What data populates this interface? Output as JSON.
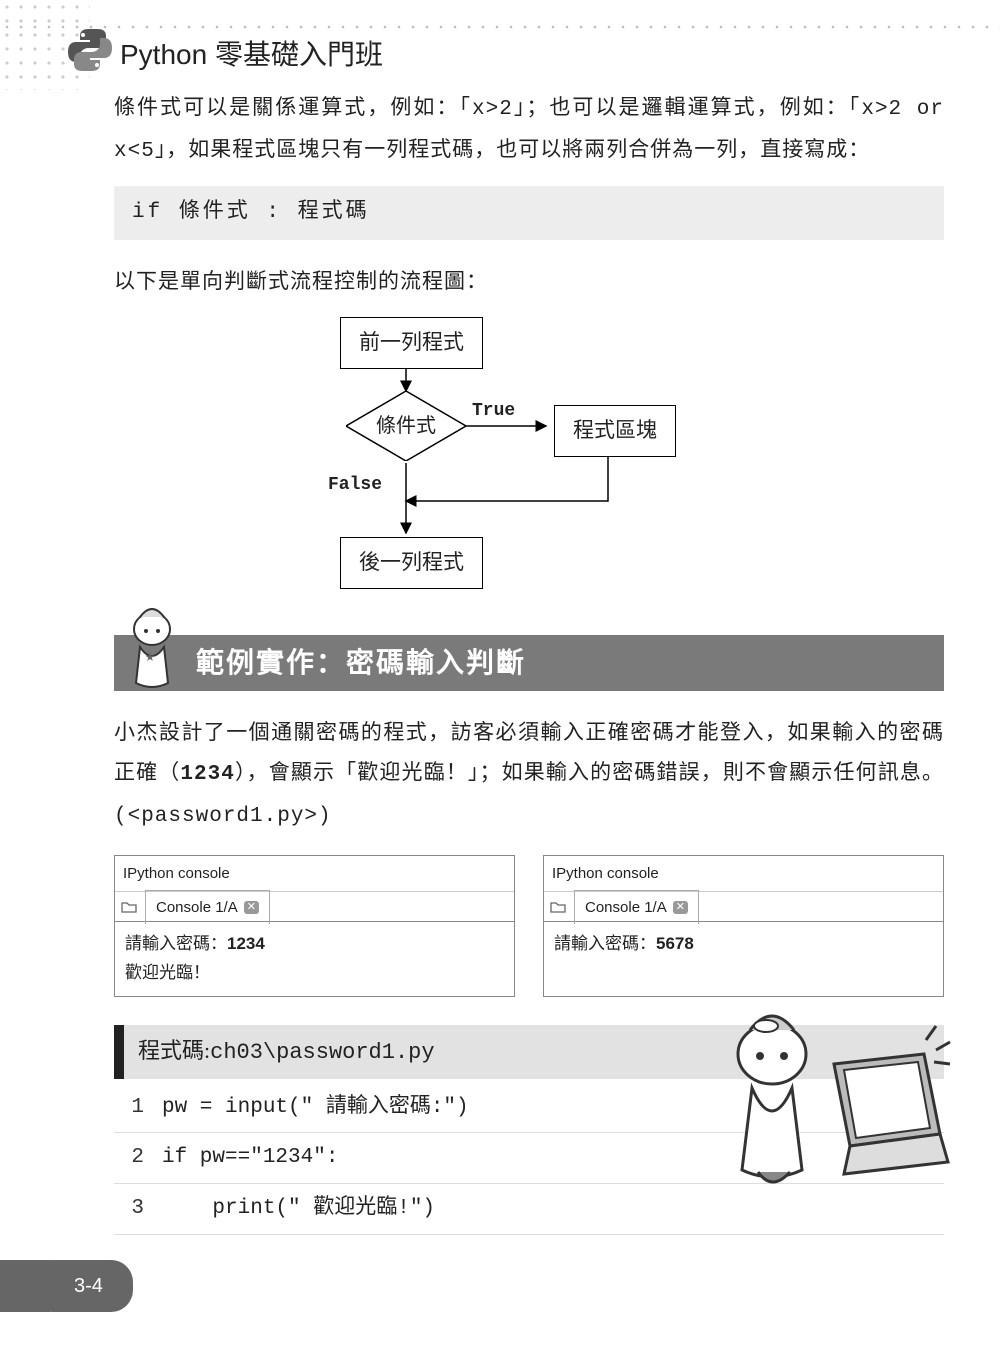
{
  "header": {
    "title": "Python 零基礎入門班"
  },
  "intro": {
    "para1_a": "條件式可以是關係運算式，例如：「",
    "expr1": "x>2",
    "para1_b": "」；也可以是邏輯運算式，例如：「",
    "expr2": "x>2 or x<5",
    "para1_c": "」，如果程式區塊只有一列程式碼，也可以將兩列合併為一列，直接寫成：",
    "codebox": "if 條件式 : 程式碼",
    "para2": "以下是單向判斷式流程控制的流程圖："
  },
  "flow": {
    "top": "前一列程式",
    "cond": "條件式",
    "true_label": "True",
    "false_label": "False",
    "block": "程式區塊",
    "bottom": "後一列程式"
  },
  "section": {
    "title": "範例實作：密碼輸入判斷"
  },
  "example": {
    "para_a": "小杰設計了一個通關密碼的程式，訪客必須輸入正確密碼才能登入，如果輸入的密碼正確（",
    "pw": "1234",
    "para_b": "），會顯示「歡迎光臨！」；如果輸入的密碼錯誤，則不會顯示任何訊息。",
    "filename": "(<password1.py>)"
  },
  "consoles": {
    "header": "IPython console",
    "tab": "Console 1/A",
    "left_body_prefix": "請輸入密碼：",
    "left_body_pw": "1234",
    "left_body_line2": "歡迎光臨！",
    "right_body_prefix": "請輸入密碼：",
    "right_body_pw": "5678"
  },
  "code": {
    "header_label": "程式碼:",
    "header_path": "ch03\\password1.py",
    "lines": [
      {
        "n": "1",
        "t": "pw = input(\" 請輸入密碼:\")"
      },
      {
        "n": "2",
        "t": "if pw==\"1234\":"
      },
      {
        "n": "3",
        "t": "    print(\" 歡迎光臨!\")"
      }
    ]
  },
  "page_number": "3-4"
}
